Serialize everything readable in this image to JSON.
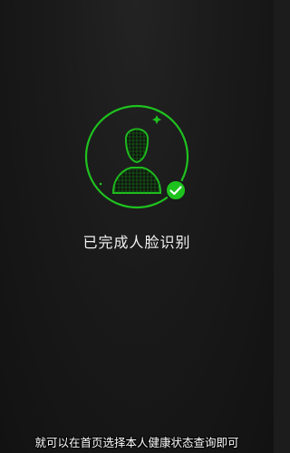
{
  "face_recognition": {
    "status_text": "已完成人脸识别",
    "success_icon": "check-icon",
    "accent_color": "#1ec21e"
  },
  "caption": {
    "text": "就可以在首页选择本人健康状态查询即可"
  }
}
